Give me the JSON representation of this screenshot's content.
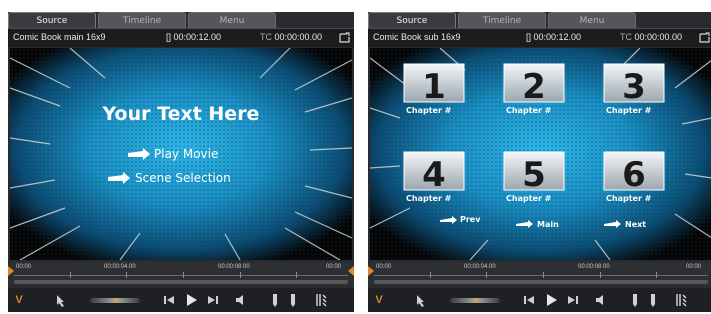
{
  "tabs": [
    "Source",
    "Timeline",
    "Menu"
  ],
  "active_tab": "Source",
  "colors": {
    "accent": "#e08a22",
    "panel": "#2a2b2e",
    "tab_active": "#3a3b3e",
    "preview_blue": "#1a8fc4"
  },
  "left": {
    "clip_name": "Comic Book main 16x9",
    "duration": "[] 00:00:12.00",
    "tc_label": "TC",
    "timecode": "00:00:00.00",
    "menu_title": "Your Text Here",
    "buttons": [
      "Play Movie",
      "Scene Selection"
    ],
    "ruler": [
      "00:00",
      "00:00:04.00",
      "00:00:08.00",
      "00:00"
    ],
    "track_indicator": "V"
  },
  "right": {
    "clip_name": "Comic Book sub 16x9",
    "duration": "[] 00:00:12.00",
    "tc_label": "TC",
    "timecode": "00:00:00.00",
    "chapters": [
      {
        "number": "1",
        "label": "Chapter #"
      },
      {
        "number": "2",
        "label": "Chapter #"
      },
      {
        "number": "3",
        "label": "Chapter #"
      },
      {
        "number": "4",
        "label": "Chapter #"
      },
      {
        "number": "5",
        "label": "Chapter #"
      },
      {
        "number": "6",
        "label": "Chapter #"
      }
    ],
    "nav": [
      "Prev",
      "Main",
      "Next"
    ],
    "ruler": [
      "00:00",
      "00:00:04.00",
      "00:00:08.00",
      "00:00"
    ],
    "track_indicator": "V"
  },
  "icons": [
    "fullscreen-icon",
    "arrow-icon",
    "jog-shuttle",
    "rewind-icon",
    "play-icon",
    "step-forward-icon",
    "audio-icon",
    "mark-in-icon",
    "mark-out-icon",
    "split-icon"
  ]
}
